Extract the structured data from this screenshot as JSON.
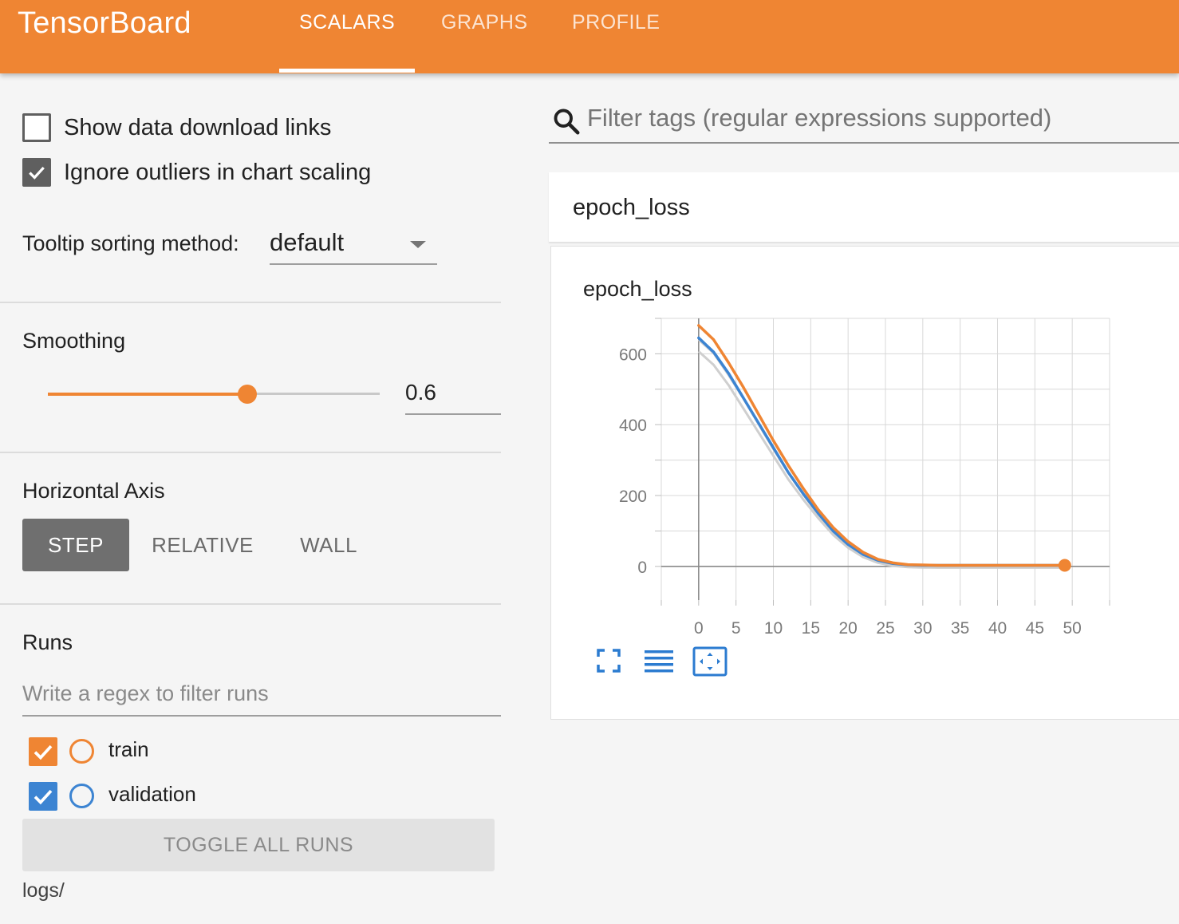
{
  "header": {
    "brand": "TensorBoard",
    "tabs": [
      {
        "label": "SCALARS",
        "active": true
      },
      {
        "label": "GRAPHS",
        "active": false
      },
      {
        "label": "PROFILE",
        "active": false
      }
    ],
    "color": "#ef8533"
  },
  "sidebar": {
    "show_download_links": {
      "label": "Show data download links",
      "checked": false
    },
    "ignore_outliers": {
      "label": "Ignore outliers in chart scaling",
      "checked": true
    },
    "tooltip_sorting": {
      "label": "Tooltip sorting method:",
      "value": "default"
    },
    "smoothing": {
      "title": "Smoothing",
      "value": "0.6",
      "fraction": 0.6
    },
    "horizontal_axis": {
      "title": "Horizontal Axis",
      "options": [
        "STEP",
        "RELATIVE",
        "WALL"
      ],
      "selected": "STEP"
    },
    "runs": {
      "title": "Runs",
      "filter_placeholder": "Write a regex to filter runs",
      "items": [
        {
          "name": "train",
          "color": "#ef8533",
          "checked": true
        },
        {
          "name": "validation",
          "color": "#3c84d2",
          "checked": true
        }
      ],
      "toggle_all_label": "TOGGLE ALL RUNS",
      "logdir": "logs/"
    }
  },
  "main": {
    "search_placeholder": "Filter tags (regular expressions supported)",
    "tag_group": "epoch_loss",
    "card_title": "epoch_loss"
  },
  "icons": {
    "search": "search-icon",
    "expand": "fullscreen-icon",
    "log_scale": "lines-icon",
    "fit_domain": "fit-domain-icon"
  },
  "chart_data": {
    "type": "line",
    "title": "epoch_loss",
    "xlabel": "",
    "ylabel": "",
    "x_ticks": [
      0,
      5,
      10,
      15,
      20,
      25,
      30,
      35,
      40,
      45,
      50
    ],
    "y_ticks": [
      0,
      200,
      400,
      600
    ],
    "xlim": [
      -5,
      55
    ],
    "ylim": [
      -95,
      700
    ],
    "grid": true,
    "series": [
      {
        "name": "train",
        "color": "#ef8533",
        "x": [
          0,
          2,
          4,
          6,
          8,
          10,
          12,
          14,
          16,
          18,
          20,
          22,
          24,
          26,
          28,
          30,
          32,
          34,
          36,
          38,
          40,
          42,
          44,
          46,
          48,
          49
        ],
        "y": [
          680,
          640,
          575,
          505,
          430,
          355,
          285,
          220,
          160,
          110,
          70,
          40,
          20,
          10,
          5,
          4,
          3,
          3,
          3,
          3,
          3,
          3,
          3,
          3,
          3,
          3
        ]
      },
      {
        "name": "validation",
        "color": "#3c84d2",
        "x": [
          0,
          2,
          4,
          6,
          8,
          10,
          12,
          14,
          16,
          18,
          20,
          22,
          24,
          26,
          28,
          30,
          32,
          34,
          36,
          38,
          40,
          42,
          44,
          46,
          48,
          49
        ],
        "y": [
          645,
          605,
          545,
          475,
          405,
          335,
          265,
          205,
          150,
          100,
          62,
          34,
          17,
          8,
          4,
          3,
          3,
          3,
          3,
          3,
          3,
          3,
          3,
          3,
          3,
          3
        ]
      }
    ]
  }
}
